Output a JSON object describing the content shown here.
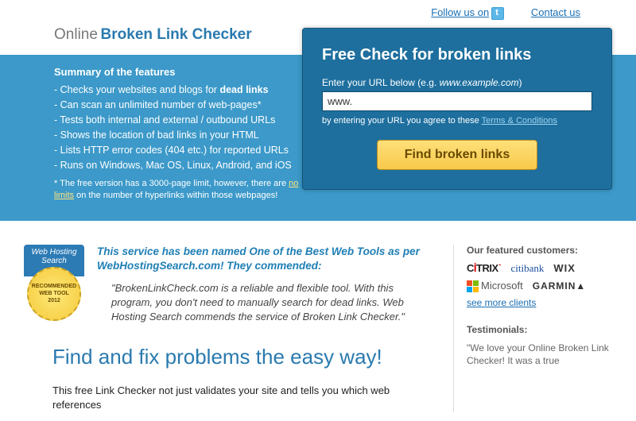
{
  "topbar": {
    "follow": "Follow us on",
    "contact": "Contact us"
  },
  "title": {
    "prefix": "Online",
    "main": "Broken Link Checker"
  },
  "features": {
    "heading": "Summary of the features",
    "items": [
      "- Checks your websites and blogs for <b>dead links</b>",
      "- Can scan an unlimited number of web-pages*",
      "- Tests both internal and external / outbound URLs",
      "- Shows the location of bad links in your HTML",
      "- Lists HTTP error codes (404 etc.) for reported URLs",
      "- Runs on Windows, Mac OS, Linux, Android, and iOS"
    ],
    "note_before": "*  The free version has a 3000-page limit, however, there are ",
    "note_link": "no limits",
    "note_after": " on the number of hyperlinks within those webpages!"
  },
  "panel": {
    "heading": "Free Check for broken links",
    "label_before": "Enter your URL below (e.g. ",
    "label_example": "www.example.com",
    "label_after": ")",
    "input_value": "www.",
    "terms_before": "by entering your URL you agree to these ",
    "terms_link": "Terms & Conditions",
    "button": "Find broken links"
  },
  "badge": {
    "ribbon1": "Web Hosting",
    "ribbon2": "Search",
    "seal1": "RECOMMENDED",
    "seal2": "WEB TOOL",
    "seal3": "2012"
  },
  "commend": "This service has been named <b>One of the Best Web Tools as per WebHostingSearch.com! They commended:</b>",
  "quote": "\"BrokenLinkCheck.com is a reliable and flexible tool. With this program, you don't need to manually search for dead links. Web Hosting Search commends the service of Broken Link Checker.\"",
  "headline": "Find and fix problems the easy way!",
  "body": "This free Link Checker not just validates your site and tells you which web references",
  "sidebar": {
    "customers_heading": "Our featured customers:",
    "see_more": "see more clients",
    "testimonials_heading": "Testimonials:",
    "testimonial": "\"We love your Online Broken Link Checker! It was a true"
  },
  "logos": {
    "citrix": "CİTRIX",
    "citi": "citibank",
    "wix": "WIX",
    "ms": "Microsoft",
    "garmin": "GARMIN"
  }
}
